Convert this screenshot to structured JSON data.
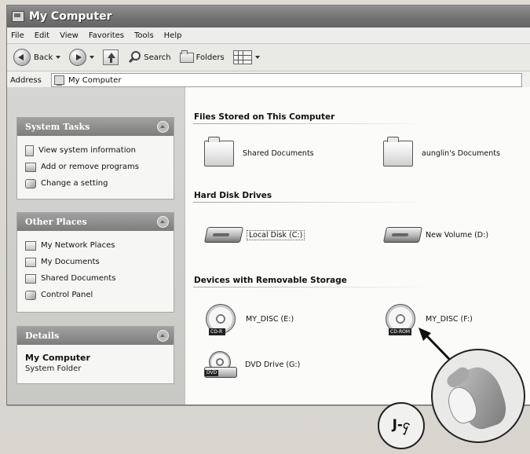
{
  "window": {
    "title": "My Computer"
  },
  "menu": [
    "File",
    "Edit",
    "View",
    "Favorites",
    "Tools",
    "Help"
  ],
  "toolbar": {
    "back": "Back",
    "search": "Search",
    "folders": "Folders"
  },
  "address": {
    "label": "Address",
    "value": "My Computer"
  },
  "sidebar": {
    "system_tasks": {
      "title": "System Tasks",
      "items": [
        "View system information",
        "Add or remove programs",
        "Change a setting"
      ]
    },
    "other_places": {
      "title": "Other Places",
      "items": [
        "My Network Places",
        "My Documents",
        "Shared Documents",
        "Control Panel"
      ]
    },
    "details": {
      "title": "Details",
      "name": "My Computer",
      "type": "System Folder"
    }
  },
  "sections": {
    "files": {
      "title": "Files Stored on This Computer",
      "items": [
        "Shared Documents",
        "aunglin's Documents"
      ]
    },
    "hard_disks": {
      "title": "Hard Disk Drives",
      "items": [
        "Local Disk (C:)",
        "New Volume (D:)"
      ]
    },
    "removable": {
      "title": "Devices with Removable Storage",
      "items": [
        "MY_DISC (E:)",
        "MY_DISC (F:)",
        "DVD Drive (G:)"
      ],
      "badges": [
        "CD-R",
        "CD-ROM",
        "DVD"
      ]
    }
  },
  "annotation": {
    "circle_text": "J-ႁ"
  }
}
